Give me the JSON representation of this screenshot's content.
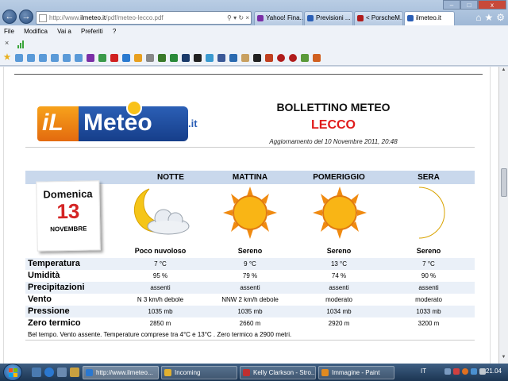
{
  "browser": {
    "address": {
      "prefix": "http://www.",
      "host": "ilmeteo.it",
      "path": "/pdf/meteo-lecco.pdf"
    },
    "tabs": [
      {
        "label": "Yahoo! Fina...",
        "color": "#7b2fa6",
        "active": false
      },
      {
        "label": "Previsioni ...",
        "color": "#2b5fb6",
        "active": false
      },
      {
        "label": "< PorscheM...",
        "color": "#b01c1c",
        "active": false
      },
      {
        "label": "ilmeteo.it",
        "color": "#2b5fb6",
        "active": true
      }
    ],
    "menu": [
      "File",
      "Modifica",
      "Vai a",
      "Preferiti",
      "?"
    ],
    "window_controls": {
      "minimize": "–",
      "maximize": "□",
      "close": "x"
    }
  },
  "bulletin": {
    "logo": {
      "il": "iL",
      "meteo": "Meteo",
      "tld": ".it"
    },
    "title": "BOLLETTINO METEO",
    "city": "LECCO",
    "updated": "Aggiornamento del 10 Novembre 2011, 20:48",
    "date": {
      "weekday": "Domenica",
      "day": "13",
      "month": "NOVEMBRE"
    },
    "periods": [
      "NOTTE",
      "MATTINA",
      "POMERIGGIO",
      "SERA"
    ],
    "icons": [
      "moon-cloud-icon",
      "sun-icon",
      "sun-icon",
      "moon-icon"
    ],
    "conditions": [
      "Poco nuvoloso",
      "Sereno",
      "Sereno",
      "Sereno"
    ],
    "rows": [
      {
        "label": "Temperatura",
        "values": [
          "7 °C",
          "9 °C",
          "13 °C",
          "7 °C"
        ]
      },
      {
        "label": "Umidità",
        "values": [
          "95 %",
          "79 %",
          "74 %",
          "90 %"
        ]
      },
      {
        "label": "Precipitazioni",
        "values": [
          "assenti",
          "assenti",
          "assenti",
          "assenti"
        ]
      },
      {
        "label": "Vento",
        "values": [
          "N 3 km/h debole",
          "NNW 2 km/h debole",
          "moderato",
          "moderato"
        ]
      },
      {
        "label": "Pressione",
        "values": [
          "1035 mb",
          "1035 mb",
          "1034 mb",
          "1033 mb"
        ]
      },
      {
        "label": "Zero termico",
        "values": [
          "2850 m",
          "2660 m",
          "2920 m",
          "3200 m"
        ]
      }
    ],
    "summary": "Bel tempo. Vento assente. Temperature comprese tra 4°C e 13°C . Zero termico a  2900 metri."
  },
  "taskbar": {
    "tasks": [
      {
        "label": "http://www.ilmeteo...",
        "color": "#2b78d0",
        "active": true
      },
      {
        "label": "Incoming",
        "color": "#e0b030",
        "active": false
      },
      {
        "label": "Kelly Clarkson - Stro...",
        "color": "#c03030",
        "active": false
      },
      {
        "label": "Immagine - Paint",
        "color": "#e08a20",
        "active": false
      }
    ],
    "language": "IT",
    "clock": "21.04"
  }
}
